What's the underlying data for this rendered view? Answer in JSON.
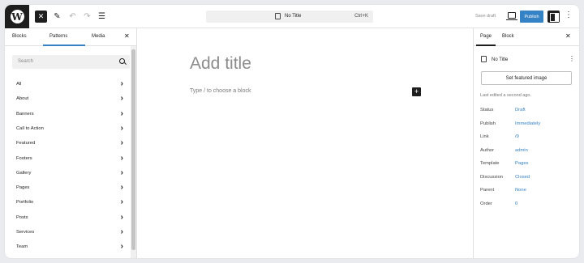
{
  "header": {
    "document_title": "No Title",
    "shortcut": "Ctrl+K",
    "save_draft": "Save draft",
    "publish": "Publish"
  },
  "inserter": {
    "tabs": [
      "Blocks",
      "Patterns",
      "Media"
    ],
    "active_tab": "Patterns",
    "search_placeholder": "Search",
    "categories": [
      "All",
      "About",
      "Banners",
      "Call to Action",
      "Featured",
      "Footers",
      "Gallery",
      "Pages",
      "Portfolio",
      "Posts",
      "Services",
      "Team"
    ]
  },
  "editor": {
    "title_placeholder": "Add title",
    "block_prompt": "Type / to choose a block"
  },
  "settings": {
    "tabs": [
      "Page",
      "Block"
    ],
    "active_tab": "Page",
    "page_title": "No Title",
    "featured_image_button": "Set featured image",
    "last_edited": "Last edited a second ago.",
    "properties": [
      {
        "label": "Status",
        "value": "Draft"
      },
      {
        "label": "Publish",
        "value": "Immediately"
      },
      {
        "label": "Link",
        "value": "/9"
      },
      {
        "label": "Author",
        "value": "admin"
      },
      {
        "label": "Template",
        "value": "Pages"
      },
      {
        "label": "Discussion",
        "value": "Closed"
      },
      {
        "label": "Parent",
        "value": "None"
      },
      {
        "label": "Order",
        "value": "0"
      }
    ]
  },
  "colors": {
    "accent": "#3582c4",
    "dark": "#1e1e1e"
  }
}
